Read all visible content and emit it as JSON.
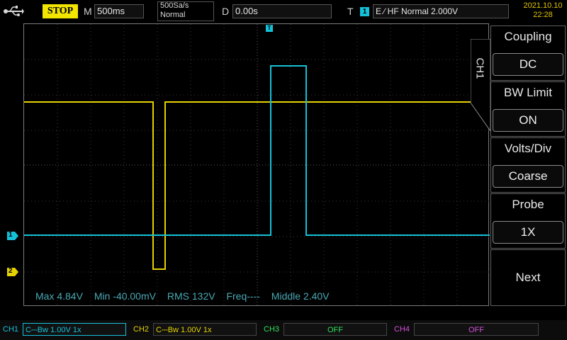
{
  "topbar": {
    "usb_icon": "usb-icon",
    "run_state": "STOP",
    "timebase_label": "M",
    "timebase_value": "500ms",
    "sample_rate": "500Sa/s",
    "acq_mode": "Normal",
    "delay_label": "D",
    "delay_value": "0.00s",
    "trigger_label": "T",
    "trigger_source": "1",
    "trigger_setting": "E ⁄ HF Normal 2.000V",
    "date": "2021.10.10",
    "time": "22:28"
  },
  "screen": {
    "trigger_marker": "T",
    "ch1_marker": "1",
    "ch2_marker": "2",
    "measurements": {
      "max": "Max 4.84V",
      "min": "Min -40.00mV",
      "rms": "RMS 132V",
      "freq": "Freq----",
      "middle": "Middle 2.40V"
    }
  },
  "menu": {
    "channel_tab": "CH1",
    "items": [
      {
        "title": "Coupling",
        "value": "DC"
      },
      {
        "title": "BW  Limit",
        "value": "ON"
      },
      {
        "title": "Volts/Div",
        "value": "Coarse"
      },
      {
        "title": "Probe",
        "value": "1X"
      },
      {
        "title": "Next"
      }
    ]
  },
  "bottombar": {
    "ch1": {
      "name": "CH1",
      "setting": "C⎓Bw 1.00V 1x"
    },
    "ch2": {
      "name": "CH2",
      "setting": "C⎓Bw 1.00V 1x"
    },
    "ch3": {
      "name": "CH3",
      "setting": "OFF"
    },
    "ch4": {
      "name": "CH4",
      "setting": "OFF"
    }
  },
  "colors": {
    "ch1": "#15c1d8",
    "ch2": "#e6d200",
    "ch3": "#2fe05a",
    "ch4": "#d24fd8",
    "stop_badge": "#f2e600"
  }
}
